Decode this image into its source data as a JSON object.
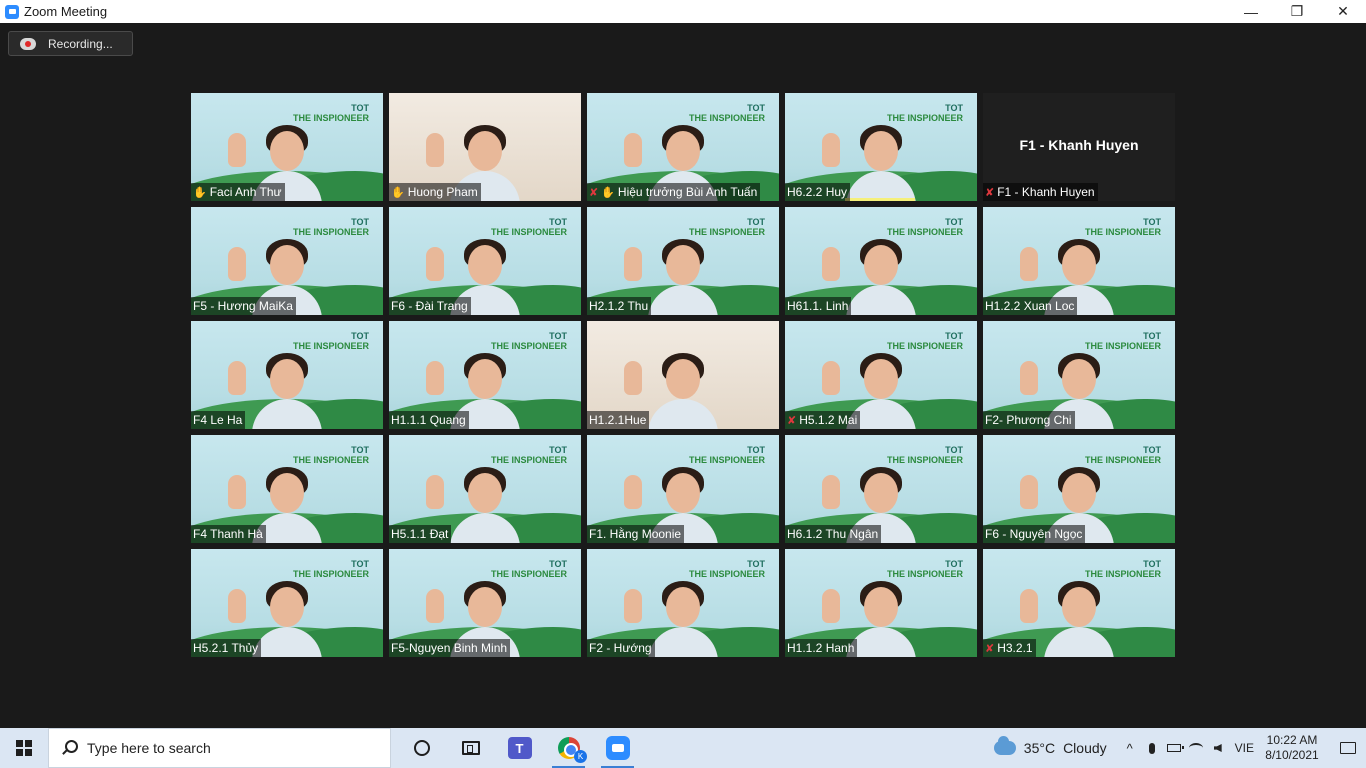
{
  "window": {
    "title": "Zoom Meeting",
    "minimize": "—",
    "restore": "❐",
    "close": "✕"
  },
  "recording": {
    "label": "Recording..."
  },
  "tile_banner": {
    "line1": "TOT",
    "line2": "THE INSPIONEER"
  },
  "participants": [
    {
      "name": "Faci Anh Thư",
      "muted": false,
      "pinned": true,
      "style": "banner"
    },
    {
      "name": "Huong Pham",
      "muted": false,
      "pinned": true,
      "style": "room"
    },
    {
      "name": "Hiệu trưởng Bùi Anh Tuấn",
      "muted": true,
      "pinned": true,
      "style": "banner"
    },
    {
      "name": "H6.2.2 Huy",
      "muted": false,
      "pinned": false,
      "style": "banner",
      "active_bar": true
    },
    {
      "name": "F1 - Khanh Huyen",
      "muted": true,
      "pinned": false,
      "style": "dark",
      "center_name": "F1 - Khanh Huyen"
    },
    {
      "name": "F5 - Hương MaiKa",
      "muted": false,
      "pinned": false,
      "style": "banner"
    },
    {
      "name": "F6 - Đài Trang",
      "muted": false,
      "pinned": false,
      "style": "banner"
    },
    {
      "name": "H2.1.2 Thu",
      "muted": false,
      "pinned": false,
      "style": "banner"
    },
    {
      "name": "H61.1. Linh",
      "muted": false,
      "pinned": false,
      "style": "banner"
    },
    {
      "name": "H1.2.2 Xuan Loc",
      "muted": false,
      "pinned": false,
      "style": "banner"
    },
    {
      "name": "F4 Le Ha",
      "muted": false,
      "pinned": false,
      "style": "banner"
    },
    {
      "name": "H1.1.1 Quang",
      "muted": false,
      "pinned": false,
      "style": "banner"
    },
    {
      "name": "H1.2.1Hue",
      "muted": false,
      "pinned": false,
      "style": "room"
    },
    {
      "name": "H5.1.2 Mai",
      "muted": true,
      "pinned": false,
      "style": "banner"
    },
    {
      "name": "F2- Phương Chi",
      "muted": false,
      "pinned": false,
      "style": "banner"
    },
    {
      "name": "F4 Thanh Hà",
      "muted": false,
      "pinned": false,
      "style": "banner"
    },
    {
      "name": "H5.1.1 Đạt",
      "muted": false,
      "pinned": false,
      "style": "banner"
    },
    {
      "name": "F1. Hằng Moonie",
      "muted": false,
      "pinned": false,
      "style": "banner"
    },
    {
      "name": "H6.1.2 Thu Ngân",
      "muted": false,
      "pinned": false,
      "style": "banner"
    },
    {
      "name": "F6 - Nguyên Ngọc",
      "muted": false,
      "pinned": false,
      "style": "banner"
    },
    {
      "name": "H5.2.1 Thủy",
      "muted": false,
      "pinned": false,
      "style": "banner"
    },
    {
      "name": "F5-Nguyen Binh Minh",
      "muted": false,
      "pinned": false,
      "style": "banner"
    },
    {
      "name": "F2 - Hướng",
      "muted": false,
      "pinned": false,
      "style": "banner"
    },
    {
      "name": "H1.1.2 Hanh",
      "muted": false,
      "pinned": false,
      "style": "banner",
      "speaking": true
    },
    {
      "name": "H3.2.1",
      "muted": true,
      "pinned": false,
      "style": "banner"
    }
  ],
  "taskbar": {
    "search_placeholder": "Type here to search",
    "teams_letter": "T",
    "chrome_badge": "K",
    "weather": {
      "temp": "35°C",
      "condition": "Cloudy"
    },
    "tray_chevron": "^",
    "language": "VIE",
    "time": "10:22 AM",
    "date": "8/10/2021"
  }
}
